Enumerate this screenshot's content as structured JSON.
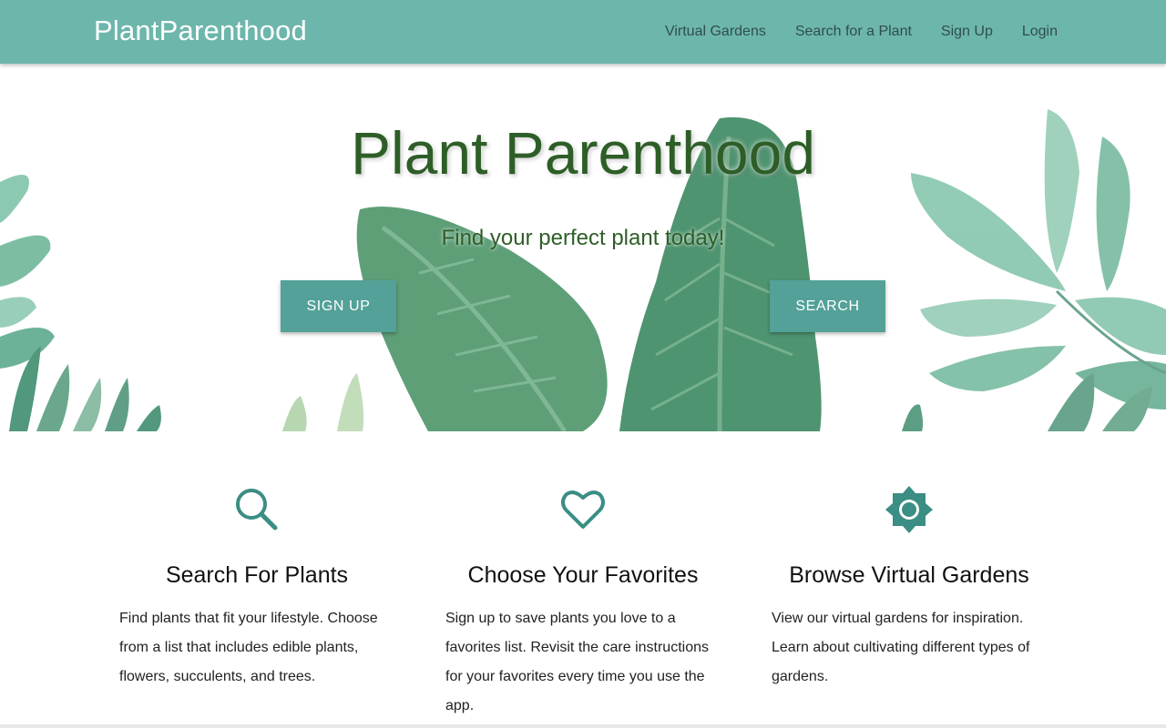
{
  "navbar": {
    "brand": "PlantParenthood",
    "links": [
      "Virtual Gardens",
      "Search for a Plant",
      "Sign Up",
      "Login"
    ],
    "background_color": "#6db6ac"
  },
  "hero": {
    "title": "Plant Parenthood",
    "subtitle": "Find your perfect plant today!",
    "signup_button": "SIGN UP",
    "search_button": "SEARCH",
    "button_color": "#53a198",
    "text_color": "#2e5e27"
  },
  "features": [
    {
      "icon": "search-icon",
      "title": "Search For Plants",
      "text": "Find plants that fit your lifestyle. Choose from a list that includes edible plants, flowers, succulents, and trees."
    },
    {
      "icon": "heart-icon",
      "title": "Choose Your Favorites",
      "text": "Sign up to save plants you love to a favorites list. Revisit the care instructions for your favorites every time you use the app."
    },
    {
      "icon": "sun-icon",
      "title": "Browse Virtual Gardens",
      "text": "View our virtual gardens for inspiration. Learn about cultivating different types of gardens."
    }
  ],
  "icon_color": "#3a8e84"
}
